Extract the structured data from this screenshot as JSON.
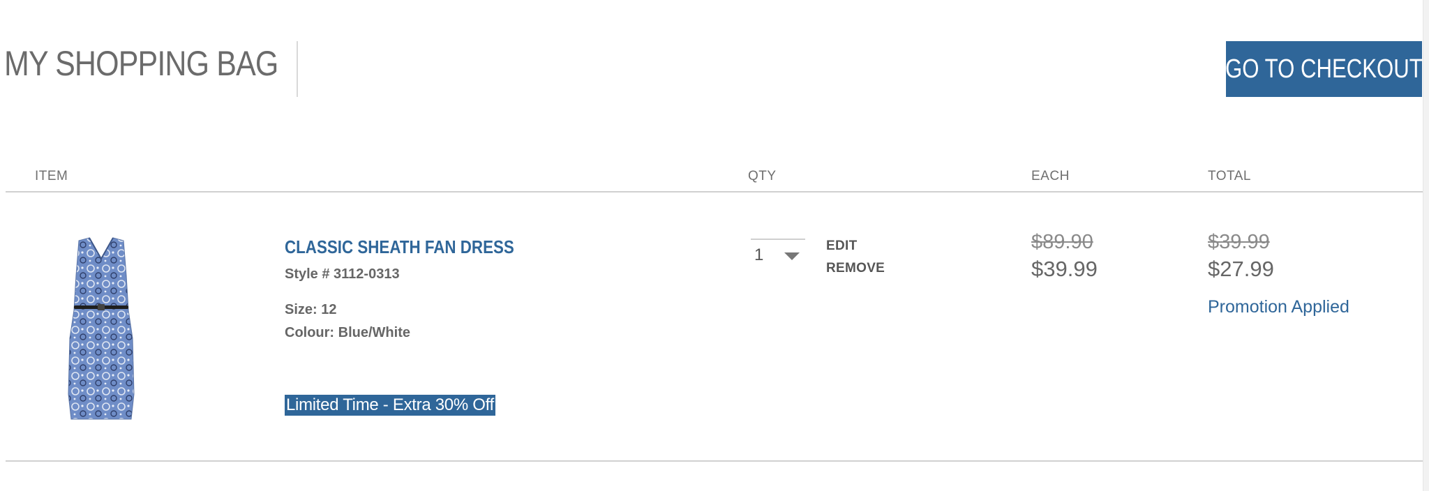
{
  "header": {
    "title": "MY SHOPPING BAG",
    "checkout_label": "GO TO CHECKOUT"
  },
  "columns": {
    "item": "ITEM",
    "qty": "QTY",
    "each": "EACH",
    "total": "TOTAL"
  },
  "cart_item": {
    "name": "CLASSIC SHEATH FAN DRESS",
    "style": "Style # 3112-0313",
    "size": "Size: 12",
    "colour": "Colour: Blue/White",
    "promo": "Limited Time - Extra 30% Off",
    "qty": "1",
    "actions": {
      "edit": "EDIT",
      "remove": "REMOVE"
    },
    "each_original": "$89.90",
    "each_price": "$39.99",
    "total_original": "$39.99",
    "total_price": "$27.99",
    "promotion_status": "Promotion Applied"
  },
  "colors": {
    "accent": "#2f6699",
    "text": "#666666",
    "rule": "#d0d0d0"
  },
  "icons": {
    "qty_dropdown": "chevron-down-icon"
  }
}
